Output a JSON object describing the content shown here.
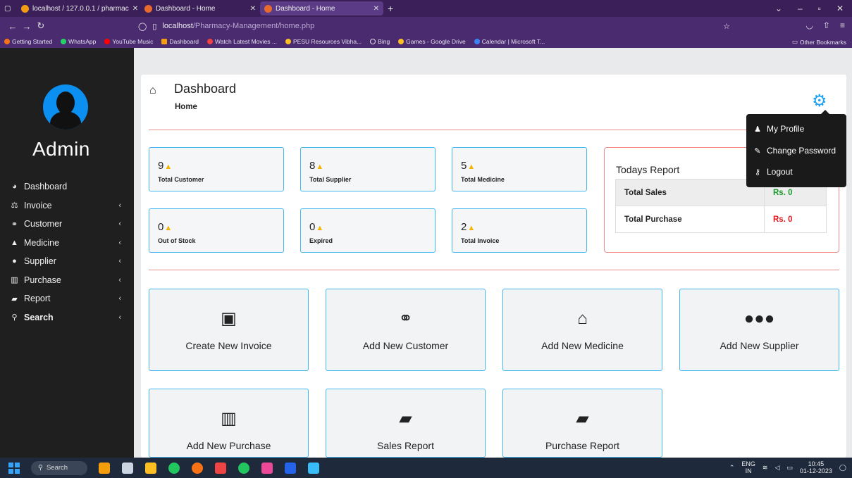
{
  "browser": {
    "tabs": [
      {
        "label": "localhost / 127.0.0.1 / pharmac",
        "active": false
      },
      {
        "label": "Dashboard - Home",
        "active": false
      },
      {
        "label": "Dashboard - Home",
        "active": true
      }
    ],
    "url_host": "localhost",
    "url_path": "/Pharmacy-Management/home.php",
    "bookmarks": [
      "Getting Started",
      "WhatsApp",
      "YouTube Music",
      "Dashboard",
      "Watch Latest Movies ...",
      "PESU Resources Vibha...",
      "Bing",
      "Games - Google Drive",
      "Calendar | Microsoft T..."
    ],
    "other_bookmarks": "Other Bookmarks"
  },
  "sidebar": {
    "user_name": "Admin",
    "items": [
      {
        "label": "Dashboard",
        "icon": "dashboard-icon",
        "has_submenu": false
      },
      {
        "label": "Invoice",
        "icon": "balance-scale-icon",
        "has_submenu": true
      },
      {
        "label": "Customer",
        "icon": "handshake-icon",
        "has_submenu": true
      },
      {
        "label": "Medicine",
        "icon": "shopping-bag-icon",
        "has_submenu": true
      },
      {
        "label": "Supplier",
        "icon": "users-icon",
        "has_submenu": true
      },
      {
        "label": "Purchase",
        "icon": "bar-chart-icon",
        "has_submenu": true
      },
      {
        "label": "Report",
        "icon": "book-icon",
        "has_submenu": true
      },
      {
        "label": "Search",
        "icon": "search-icon",
        "has_submenu": true
      }
    ]
  },
  "header": {
    "title": "Dashboard",
    "breadcrumb": "Home"
  },
  "stats": [
    {
      "value": "9",
      "label": "Total Customer"
    },
    {
      "value": "8",
      "label": "Total Supplier"
    },
    {
      "value": "5",
      "label": "Total Medicine"
    },
    {
      "value": "0",
      "label": "Out of Stock"
    },
    {
      "value": "0",
      "label": "Expired"
    },
    {
      "value": "2",
      "label": "Total Invoice"
    }
  ],
  "report": {
    "title": "Todays Report",
    "rows": [
      {
        "label": "Total Sales",
        "value": "Rs. 0"
      },
      {
        "label": "Total Purchase",
        "value": "Rs. 0"
      }
    ]
  },
  "actions": [
    {
      "label": "Create New Invoice",
      "icon": "id-card-icon"
    },
    {
      "label": "Add New Customer",
      "icon": "handshake-icon"
    },
    {
      "label": "Add New Medicine",
      "icon": "shopping-bag-icon"
    },
    {
      "label": "Add New Supplier",
      "icon": "users-icon"
    },
    {
      "label": "Add New Purchase",
      "icon": "bar-chart-icon"
    },
    {
      "label": "Sales Report",
      "icon": "book-icon"
    },
    {
      "label": "Purchase Report",
      "icon": "book-icon"
    }
  ],
  "dropdown": {
    "items": [
      {
        "label": "My Profile",
        "icon": "user-icon"
      },
      {
        "label": "Change Password",
        "icon": "edit-icon"
      },
      {
        "label": "Logout",
        "icon": "key-icon"
      }
    ]
  },
  "taskbar": {
    "search_label": "Search",
    "lang_top": "ENG",
    "lang_bottom": "IN",
    "time": "10:45",
    "date": "01-12-2023"
  },
  "colors": {
    "accent": "#45b7ef",
    "gear": "#1da1f2",
    "sales_value": "#1a9b2b",
    "purchase_value": "#e0171f",
    "warning_triangle": "#f5b400",
    "divider": "#e88c8c"
  }
}
